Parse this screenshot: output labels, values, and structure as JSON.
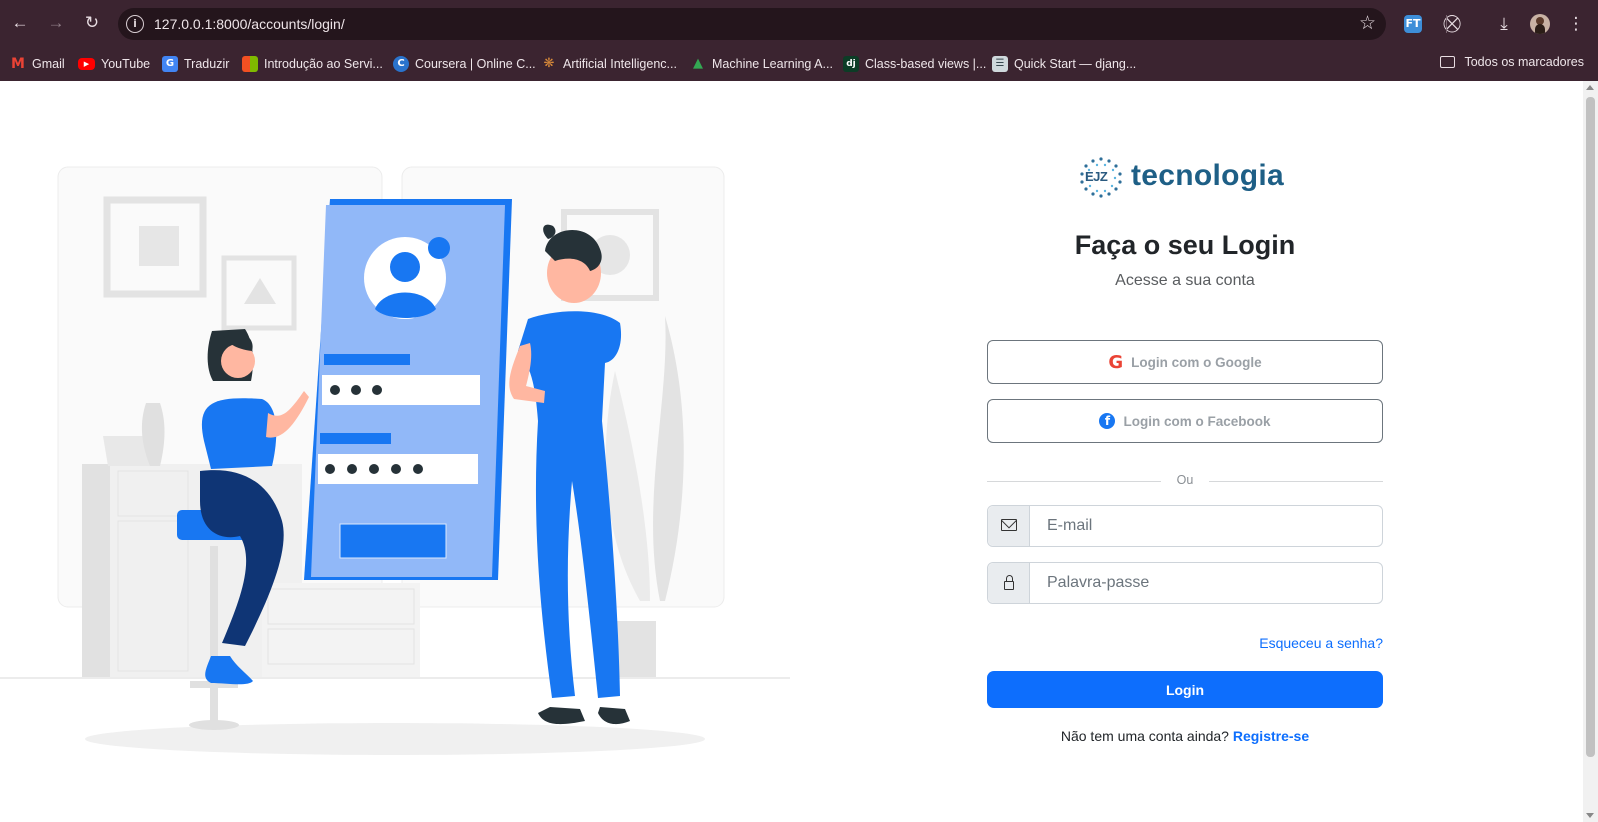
{
  "browser": {
    "url": "127.0.0.1:8000/accounts/login/",
    "extension_badge": "FT",
    "bookmarks": [
      {
        "label": "Gmail",
        "icon": "gmail-icon"
      },
      {
        "label": "YouTube",
        "icon": "youtube-icon"
      },
      {
        "label": "Traduzir",
        "icon": "google-translate-icon"
      },
      {
        "label": "Introdução ao Servi...",
        "icon": "microsoft-icon"
      },
      {
        "label": "Coursera | Online C...",
        "icon": "coursera-icon"
      },
      {
        "label": "Artificial Intelligenc...",
        "icon": "ai-site-icon"
      },
      {
        "label": "Machine Learning A...",
        "icon": "google-drive-icon"
      },
      {
        "label": "Class-based views |...",
        "icon": "django-icon"
      },
      {
        "label": "Quick Start — djang...",
        "icon": "docs-icon"
      }
    ],
    "all_bookmarks": "Todos os marcadores"
  },
  "login": {
    "logo_badge": "EJZ",
    "logo_text": "tecnologia",
    "title": "Faça o seu Login",
    "subtitle": "Acesse a sua conta",
    "google_label": "Login com o Google",
    "facebook_label": "Login com o Facebook",
    "divider": "Ou",
    "email_placeholder": "E-mail",
    "password_placeholder": "Palavra-passe",
    "forgot": "Esqueceu a senha?",
    "submit": "Login",
    "register_prompt": "Não tem uma conta ainda?",
    "register_link": "Registre-se"
  },
  "colors": {
    "primary": "#0d6efd",
    "illustration_blue": "#1877f2",
    "chrome": "#3b2430"
  }
}
